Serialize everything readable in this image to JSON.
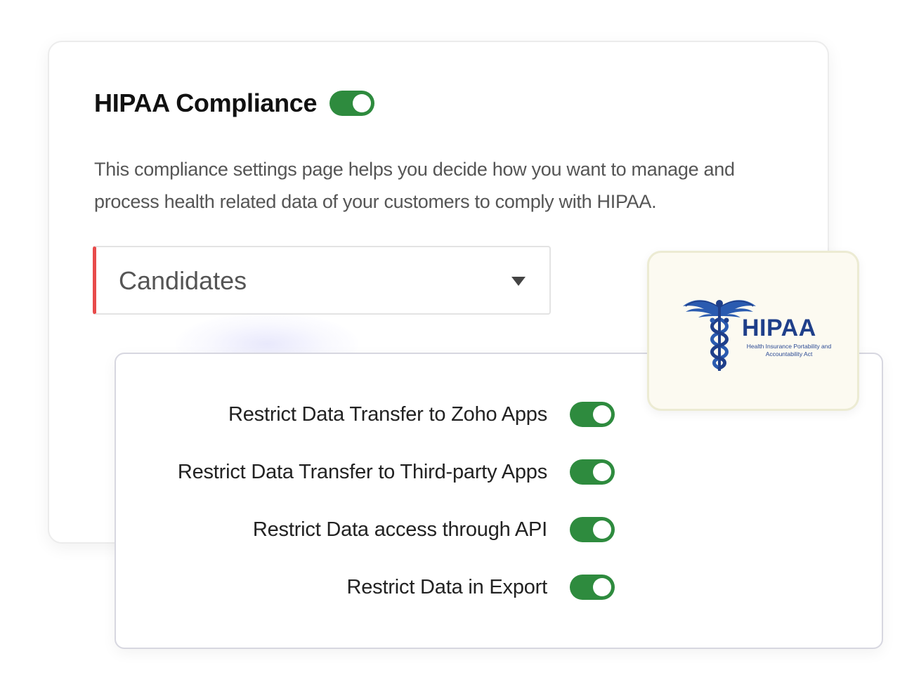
{
  "compliance": {
    "title": "HIPAA Compliance",
    "enabled": true,
    "description": "This compliance settings page helps you decide how you want to manage and process health related data of your customers to comply with HIPAA."
  },
  "module_select": {
    "selected": "Candidates"
  },
  "settings": [
    {
      "label": "Restrict Data Transfer to Zoho Apps",
      "enabled": true
    },
    {
      "label": "Restrict Data Transfer to Third-party Apps",
      "enabled": true
    },
    {
      "label": "Restrict Data access through API",
      "enabled": true
    },
    {
      "label": "Restrict Data in Export",
      "enabled": true
    }
  ],
  "badge": {
    "title": "HIPAA",
    "subtitle": "Health Insurance Portability and Accountability Act",
    "icon": "caduceus-icon"
  },
  "colors": {
    "toggle_on": "#2e8b3e",
    "select_accent": "#e84b4b",
    "badge_blue": "#1f3f8a",
    "badge_bg": "#fcfaf1"
  }
}
